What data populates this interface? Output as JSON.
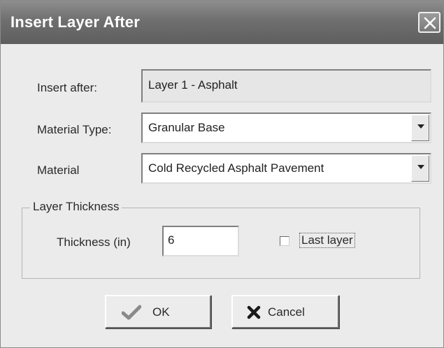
{
  "window": {
    "title": "Insert Layer After",
    "close_icon": "close-icon"
  },
  "form": {
    "insert_after": {
      "label": "Insert after:",
      "value": "Layer 1 - Asphalt"
    },
    "material_type": {
      "label": "Material Type:",
      "value": "Granular Base"
    },
    "material": {
      "label": "Material",
      "value": "Cold Recycled Asphalt Pavement"
    }
  },
  "thickness_group": {
    "title": "Layer Thickness",
    "thickness_label": "Thickness (in)",
    "thickness_value": "6",
    "last_layer_label": "Last layer",
    "last_layer_checked": false
  },
  "buttons": {
    "ok_label": "OK",
    "ok_icon": "checkmark-icon",
    "cancel_label": "Cancel",
    "cancel_icon": "x-mark-icon"
  },
  "colors": {
    "titlebar": "#6f6f6f",
    "dialog_bg": "#ebebeb",
    "ok_icon": "#8a8a8a",
    "cancel_icon": "#1a1a1a"
  }
}
